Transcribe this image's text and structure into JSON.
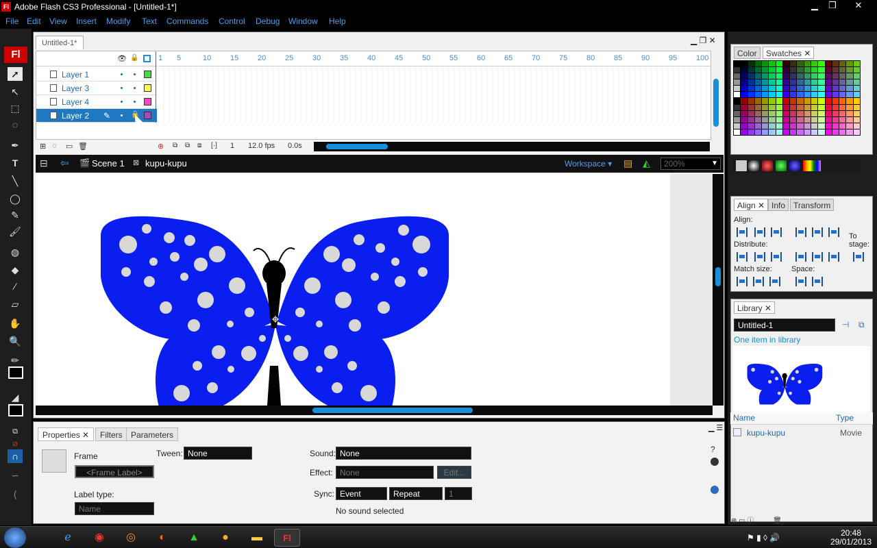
{
  "window": {
    "app_icon_label": "Fl",
    "title": "Adobe Flash CS3 Professional - [Untitled-1*]",
    "minimize": "▁",
    "restore": "❐",
    "close": "✕"
  },
  "menu": [
    "File",
    "Edit",
    "View",
    "Insert",
    "Modify",
    "Text",
    "Commands",
    "Control",
    "Debug",
    "Window",
    "Help"
  ],
  "tools": {
    "logo": "Fl"
  },
  "document": {
    "tab_label": "Untitled-1*"
  },
  "timeline": {
    "layers": [
      {
        "name": "Layer 1",
        "color": "#44dd44",
        "selected": false
      },
      {
        "name": "Layer 3",
        "color": "#ffff44",
        "selected": false
      },
      {
        "name": "Layer 4",
        "color": "#ff44cc",
        "selected": false
      },
      {
        "name": "Layer 2",
        "color": "#aa44cc",
        "selected": true
      }
    ],
    "ruler_marks": [
      "1",
      "5",
      "10",
      "15",
      "20",
      "25",
      "30",
      "35",
      "40",
      "45",
      "50",
      "55",
      "60",
      "65",
      "70",
      "75",
      "80",
      "85",
      "90",
      "95",
      "100"
    ],
    "current_frame": "1",
    "frame_rate": "12.0 fps",
    "elapsed": "0.0s"
  },
  "editbar": {
    "scene": "Scene 1",
    "symbol": "kupu-kupu",
    "workspace": "Workspace",
    "zoom": "200%"
  },
  "properties": {
    "tabs": [
      "Properties",
      "Filters",
      "Parameters"
    ],
    "frame_label": "Frame",
    "frame_label_placeholder": "<Frame Label>",
    "tween_label": "Tween:",
    "tween_value": "None",
    "label_type_label": "Label type:",
    "label_type_value": "Name",
    "sound_label": "Sound:",
    "sound_value": "None",
    "effect_label": "Effect:",
    "effect_value": "None",
    "edit_button": "Edit...",
    "sync_label": "Sync:",
    "sync_value": "Event",
    "repeat_value": "Repeat",
    "repeat_count": "1",
    "sound_status": "No sound selected"
  },
  "color_panel": {
    "tabs": [
      "Color",
      "Swatches"
    ]
  },
  "align_panel": {
    "tabs": [
      "Align",
      "Info",
      "Transform"
    ],
    "align_label": "Align:",
    "distribute_label": "Distribute:",
    "match_size_label": "Match size:",
    "space_label": "Space:",
    "to_stage_label": "To stage:"
  },
  "library": {
    "tab": "Library",
    "document": "Untitled-1",
    "count_text": "One item in library",
    "col_name": "Name",
    "col_type": "Type",
    "items": [
      {
        "name": "kupu-kupu",
        "type": "Movie"
      }
    ]
  },
  "taskbar": {
    "time": "20:48",
    "date": "29/01/2013",
    "flash_label": "Fl"
  },
  "colors": {
    "accent": "#1a8fd8",
    "butterfly": "#0a1ef0",
    "link_blue": "#4a9fe6"
  }
}
